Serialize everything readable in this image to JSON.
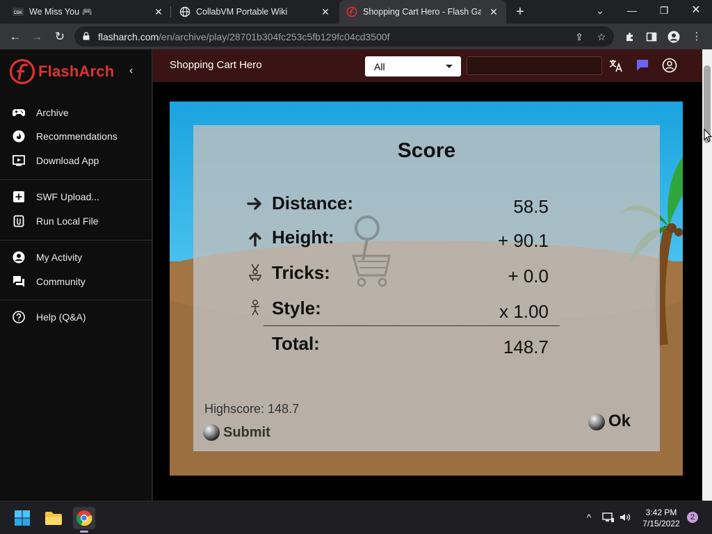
{
  "browser": {
    "tabs": [
      {
        "favicon_text": "CBK",
        "title": "We Miss You 🎮",
        "active": false
      },
      {
        "title": "CollabVM Portable Wiki",
        "active": false
      },
      {
        "title": "Shopping Cart Hero - Flash Game",
        "active": true
      }
    ],
    "new_tab_label": "+",
    "url_host": "flasharch.com",
    "url_path": "/en/archive/play/28701b304fc253c5fb129fc04cd3500f"
  },
  "site": {
    "brand": "FlashArch",
    "game_title": "Shopping Cart Hero",
    "filter_value": "All",
    "search_value": "",
    "nav_group1": [
      "Archive",
      "Recommendations",
      "Download App"
    ],
    "nav_group2": [
      "SWF Upload...",
      "Run Local File"
    ],
    "nav_group3": [
      "My Activity",
      "Community"
    ],
    "nav_group4": [
      "Help (Q&A)"
    ]
  },
  "game": {
    "score_title": "Score",
    "rows": [
      {
        "label": "Distance:",
        "value": "58.5",
        "icon": "arrow-right-icon"
      },
      {
        "label": "Height:",
        "value": "+ 90.1",
        "icon": "arrow-up-icon"
      },
      {
        "label": "Tricks:",
        "value": "+ 0.0",
        "icon": "tricks-icon"
      },
      {
        "label": "Style:",
        "value": "x 1.00",
        "icon": "stick-figure-icon"
      }
    ],
    "total_label": "Total:",
    "total_value": "148.7",
    "highscore_text": "Highscore: 148.7",
    "submit_label": "Submit",
    "ok_label": "Ok"
  },
  "taskbar": {
    "time": "3:42 PM",
    "date": "7/15/2022",
    "notification_count": "2"
  }
}
